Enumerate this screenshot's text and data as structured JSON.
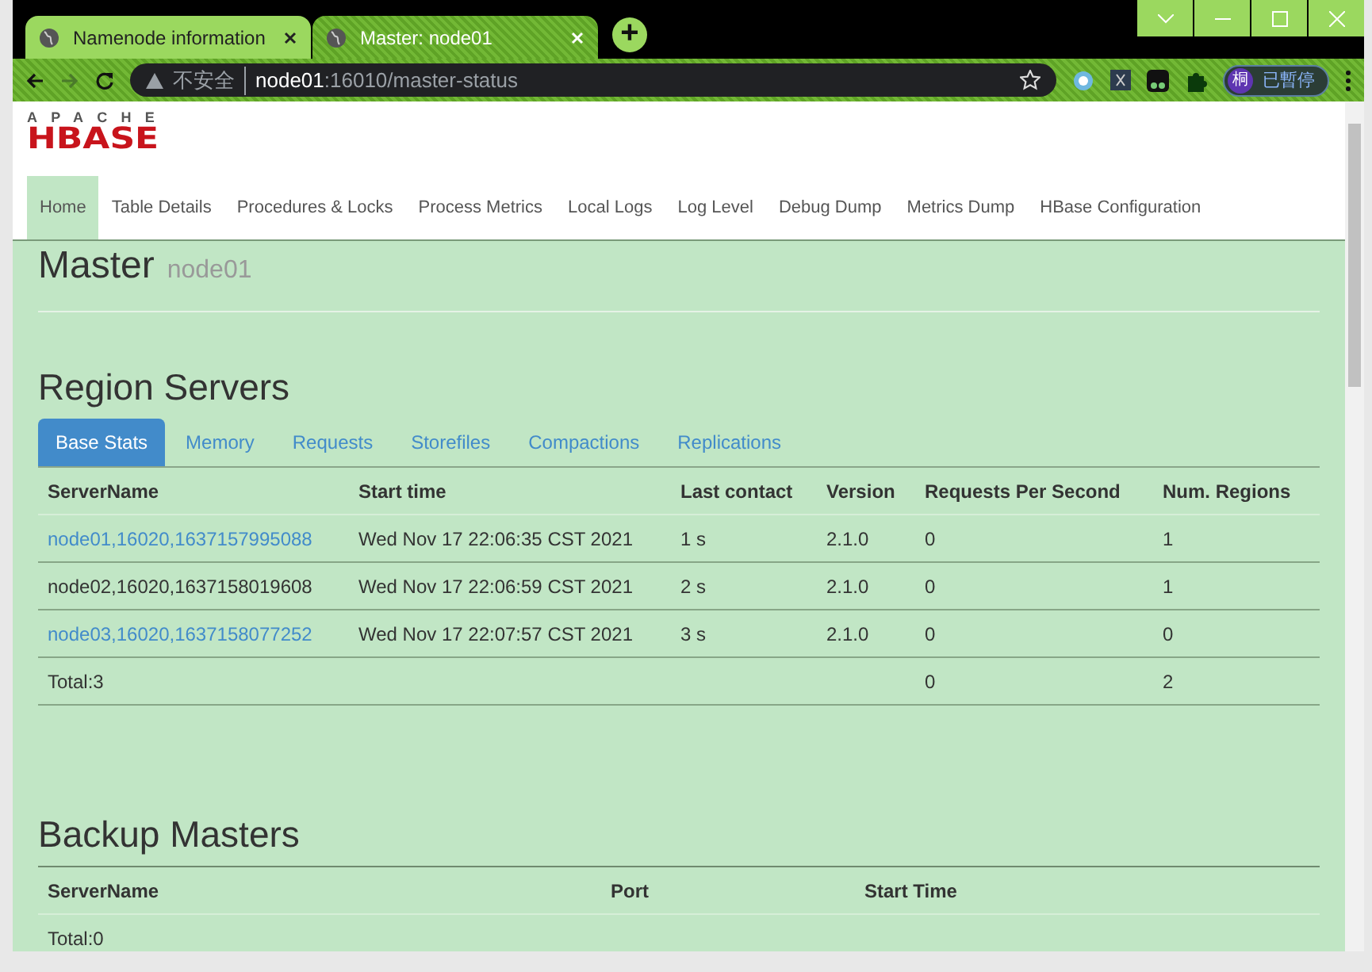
{
  "browser": {
    "tabs": [
      {
        "title": "Namenode information",
        "selected": false
      },
      {
        "title": "Master: node01",
        "selected": true
      }
    ],
    "new_tab": "+",
    "address": {
      "security": "不安全",
      "host": "node01",
      "path": ":16010/master-status"
    },
    "profile": {
      "initial": "桐",
      "label": "已暫停"
    }
  },
  "logo": {
    "top": "APACHE",
    "bottom": "HBASE"
  },
  "nav": [
    {
      "label": "Home",
      "selected": true
    },
    {
      "label": "Table Details",
      "selected": false
    },
    {
      "label": "Procedures & Locks",
      "selected": false
    },
    {
      "label": "Process Metrics",
      "selected": false
    },
    {
      "label": "Local Logs",
      "selected": false
    },
    {
      "label": "Log Level",
      "selected": false
    },
    {
      "label": "Debug Dump",
      "selected": false
    },
    {
      "label": "Metrics Dump",
      "selected": false
    },
    {
      "label": "HBase Configuration",
      "selected": false
    }
  ],
  "master": {
    "title": "Master",
    "host": "node01"
  },
  "region_servers": {
    "title": "Region Servers",
    "tabs": [
      {
        "label": "Base Stats",
        "selected": true
      },
      {
        "label": "Memory",
        "selected": false
      },
      {
        "label": "Requests",
        "selected": false
      },
      {
        "label": "Storefiles",
        "selected": false
      },
      {
        "label": "Compactions",
        "selected": false
      },
      {
        "label": "Replications",
        "selected": false
      }
    ],
    "columns": [
      "ServerName",
      "Start time",
      "Last contact",
      "Version",
      "Requests Per Second",
      "Num. Regions"
    ],
    "rows": [
      {
        "cells": [
          "node01,16020,1637157995088",
          "Wed Nov 17 22:06:35 CST 2021",
          "1 s",
          "2.1.0",
          "0",
          "1"
        ],
        "link": true
      },
      {
        "cells": [
          "node02,16020,1637158019608",
          "Wed Nov 17 22:06:59 CST 2021",
          "2 s",
          "2.1.0",
          "0",
          "1"
        ],
        "link": false
      },
      {
        "cells": [
          "node03,16020,1637158077252",
          "Wed Nov 17 22:07:57 CST 2021",
          "3 s",
          "2.1.0",
          "0",
          "0"
        ],
        "link": true
      }
    ],
    "total": {
      "label": "Total:3",
      "requests": "0",
      "regions": "2"
    }
  },
  "backup_masters": {
    "title": "Backup Masters",
    "columns": [
      "ServerName",
      "Port",
      "Start Time"
    ],
    "total": "Total:0"
  }
}
